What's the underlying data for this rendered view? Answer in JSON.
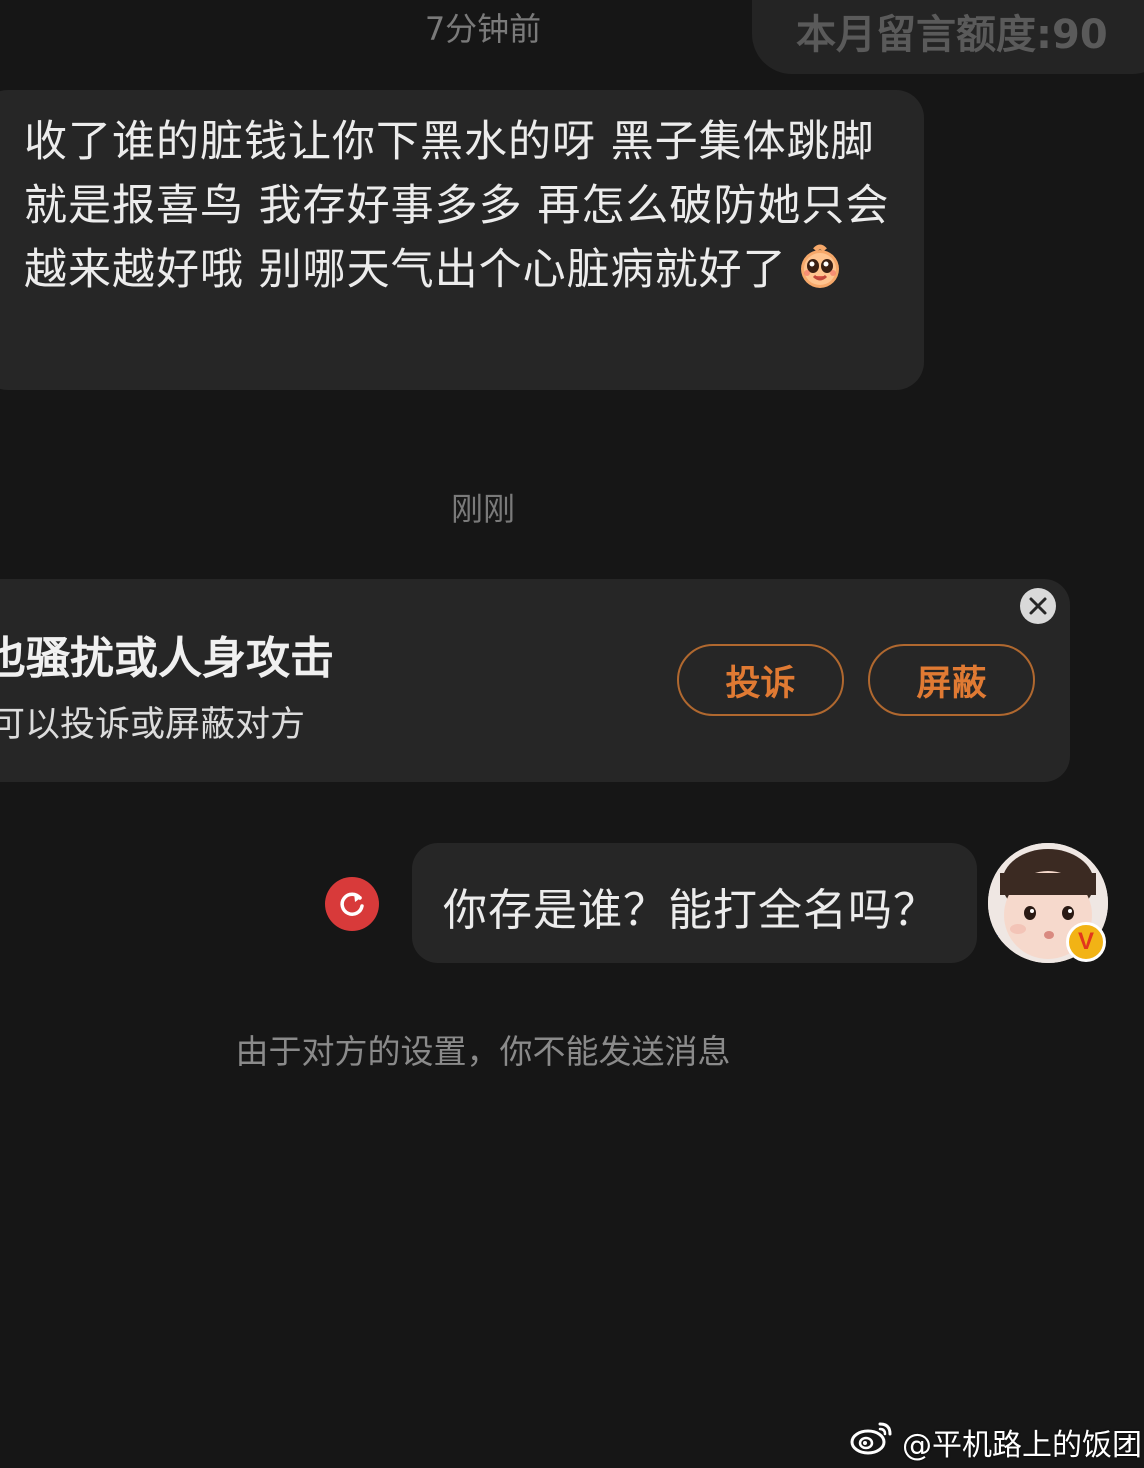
{
  "header": {
    "timestamp_top": "7分钟前",
    "quota_label": "本月留言额度:90"
  },
  "incoming_message": {
    "text": "收了谁的脏钱让你下黑水的呀 黑子集体跳脚就是报喜鸟 我存好事多多 再怎么破防她只会越来越好哦 别哪天气出个心脏病就好了",
    "emoji": "shining-eyes-sticker"
  },
  "timestamp_middle": "刚刚",
  "warning_card": {
    "title": "也骚扰或人身攻击",
    "subtitle": "可以投诉或屏蔽对方",
    "complain_label": "投诉",
    "block_label": "屏蔽",
    "close_icon": "close-icon",
    "accent_color": "#e07a33"
  },
  "outgoing_message": {
    "text": "你存是谁？能打全名吗？",
    "status_icon": "retry-icon",
    "status_color": "#d83a3a",
    "verified_badge": "V"
  },
  "notice": "由于对方的设置，你不能发送消息",
  "watermark": "@平机路上的饭团"
}
